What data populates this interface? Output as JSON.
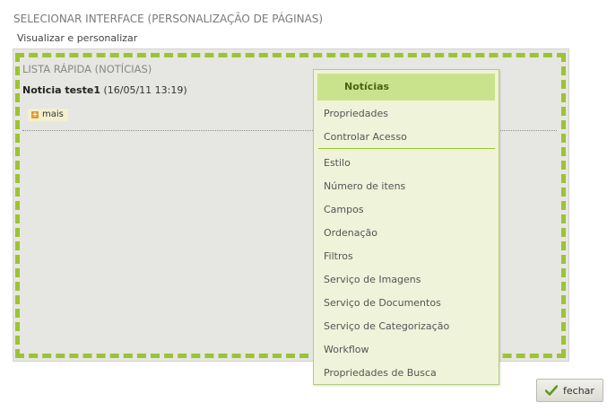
{
  "header": {
    "title": "SELECIONAR INTERFACE (PERSONALIZAÇÃO DE PÁGINAS)",
    "subtitle": "Visualizar e personalizar"
  },
  "widget": {
    "title": "LISTA RÁPIDA (NOTÍCIAS)",
    "news_title": "Noticia teste1",
    "news_date": "(16/05/11 13:19)",
    "more_label": "mais"
  },
  "menu": {
    "header": "Notícias",
    "items": [
      "Propriedades",
      "Controlar Acesso",
      "Estilo",
      "Número de itens",
      "Campos",
      "Ordenação",
      "Filtros",
      "Serviço de Imagens",
      "Serviço de Documentos",
      "Serviço de Categorização",
      "Workflow",
      "Propriedades de Busca"
    ]
  },
  "footer": {
    "close_label": "fechar"
  },
  "colors": {
    "accent_green": "#9cc432",
    "menu_header_bg": "#c9e38c",
    "menu_bg": "#eef3d9",
    "panel_bg": "#e6e6e2"
  },
  "icons": {
    "more": "plus-icon",
    "close": "check-icon"
  }
}
